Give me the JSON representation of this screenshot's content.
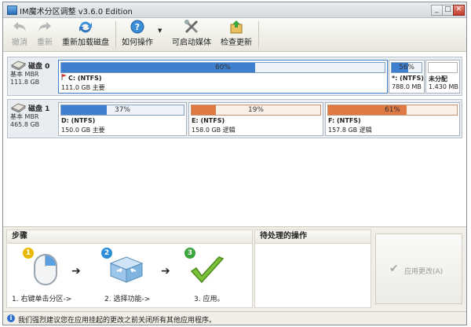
{
  "window": {
    "title": "IM魔术分区调整 v3.6.0  Edition",
    "controls": {
      "minimize": "_",
      "maximize": "□",
      "close": "✕"
    }
  },
  "toolbar": {
    "undo": "撤消",
    "redo": "重新",
    "reload_disks": "重新加载磁盘",
    "how_to": "如何操作",
    "boot_media": "可启动媒体",
    "check_updates": "检查更新"
  },
  "disks": [
    {
      "name": "磁盘 0",
      "type": "基本 MBR",
      "size": "111.8 GB",
      "partitions": [
        {
          "usage": "60%",
          "used_fraction": 0.6,
          "name": "C: (NTFS)",
          "detail": "111.0 GB 主要",
          "color": "#3f7fd0",
          "flag": true
        },
        {
          "usage": "56%",
          "used_fraction": 0.56,
          "name": "*: (NTFS)",
          "detail": "788.0 MB",
          "color": "#3f7fd0"
        },
        {
          "usage": "",
          "used_fraction": 0,
          "name": "未分配",
          "detail": "1.430 MB",
          "color": "#3f7fd0"
        }
      ]
    },
    {
      "name": "磁盘 1",
      "type": "基本 MBR",
      "size": "465.8 GB",
      "partitions": [
        {
          "usage": "37%",
          "used_fraction": 0.37,
          "name": "D: (NTFS)",
          "detail": "150.0 GB 主要",
          "color": "#3f7fd0"
        },
        {
          "usage": "19%",
          "used_fraction": 0.19,
          "name": "E: (NTFS)",
          "detail": "158.0 GB 逻辑",
          "color": "#e07a45"
        },
        {
          "usage": "61%",
          "used_fraction": 0.61,
          "name": "F: (NTFS)",
          "detail": "157.8 GB 逻辑",
          "color": "#e07a45"
        }
      ]
    }
  ],
  "steps_panel": {
    "title": "步骤",
    "steps": [
      {
        "number": "1",
        "label": "1. 右键单击分区->",
        "color": "#e8b800"
      },
      {
        "number": "2",
        "label": "2. 选择功能->",
        "color": "#2a8fd8"
      },
      {
        "number": "3",
        "label": "3. 应用。",
        "color": "#3aa53a"
      }
    ]
  },
  "pending_panel": {
    "title": "待处理的操作"
  },
  "apply_button": {
    "label": "应用更改(A)"
  },
  "status": {
    "message": "我们强烈建议您在应用挂起的更改之前关闭所有其他应用程序。"
  }
}
